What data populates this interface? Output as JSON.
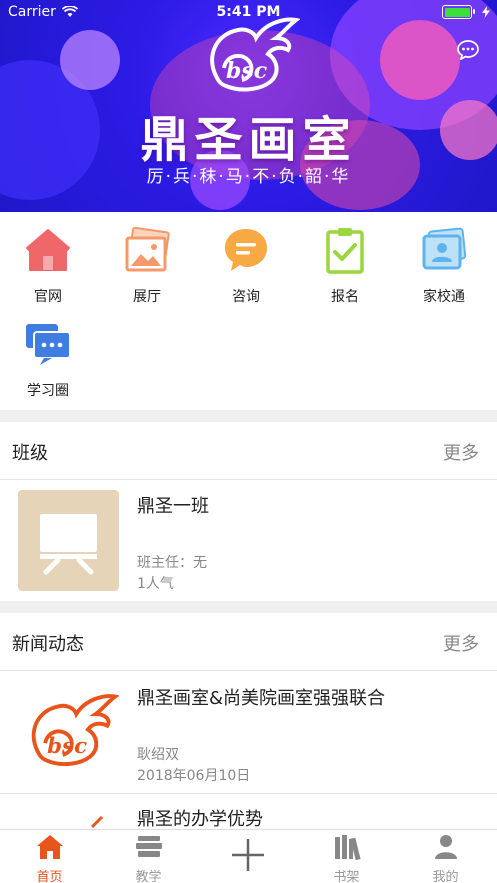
{
  "status_bar": {
    "carrier": "Carrier",
    "time": "5:41 PM"
  },
  "banner": {
    "logo_text": "DSC",
    "title": "鼎圣画室",
    "slogan": "厉·兵·秣·马·不·负·韶·华"
  },
  "quick_links": [
    {
      "label": "官网",
      "icon": "home-icon",
      "color": "#f0676a"
    },
    {
      "label": "展厅",
      "icon": "gallery-icon",
      "color": "#f49a6a"
    },
    {
      "label": "咨询",
      "icon": "consult-icon",
      "color": "#f7a944"
    },
    {
      "label": "报名",
      "icon": "signup-icon",
      "color": "#9bd63d"
    },
    {
      "label": "家校通",
      "icon": "home-school-icon",
      "color": "#5db4ec"
    },
    {
      "label": "学习圈",
      "icon": "study-circle-icon",
      "color": "#3f7de3"
    }
  ],
  "class_section": {
    "title": "班级",
    "more": "更多",
    "card": {
      "name": "鼎圣一班",
      "teacher": "班主任：无",
      "popularity": "1人气"
    }
  },
  "news_section": {
    "title": "新闻动态",
    "more": "更多",
    "items": [
      {
        "title": "鼎圣画室&尚美院画室强强联合",
        "author": "耿绍双",
        "date": "2018年06月10日"
      },
      {
        "title": "鼎圣的办学优势"
      }
    ]
  },
  "tab_bar": [
    {
      "label": "首页",
      "icon": "home-tab-icon",
      "active": true
    },
    {
      "label": "教学",
      "icon": "teaching-tab-icon",
      "active": false
    },
    {
      "label": "",
      "icon": "plus-tab-icon",
      "active": false
    },
    {
      "label": "书架",
      "icon": "bookshelf-tab-icon",
      "active": false
    },
    {
      "label": "我的",
      "icon": "profile-tab-icon",
      "active": false
    }
  ],
  "colors": {
    "accent": "#e8541a",
    "banner_blue": "#2d1be6",
    "logo_orange": "#e8541a"
  }
}
